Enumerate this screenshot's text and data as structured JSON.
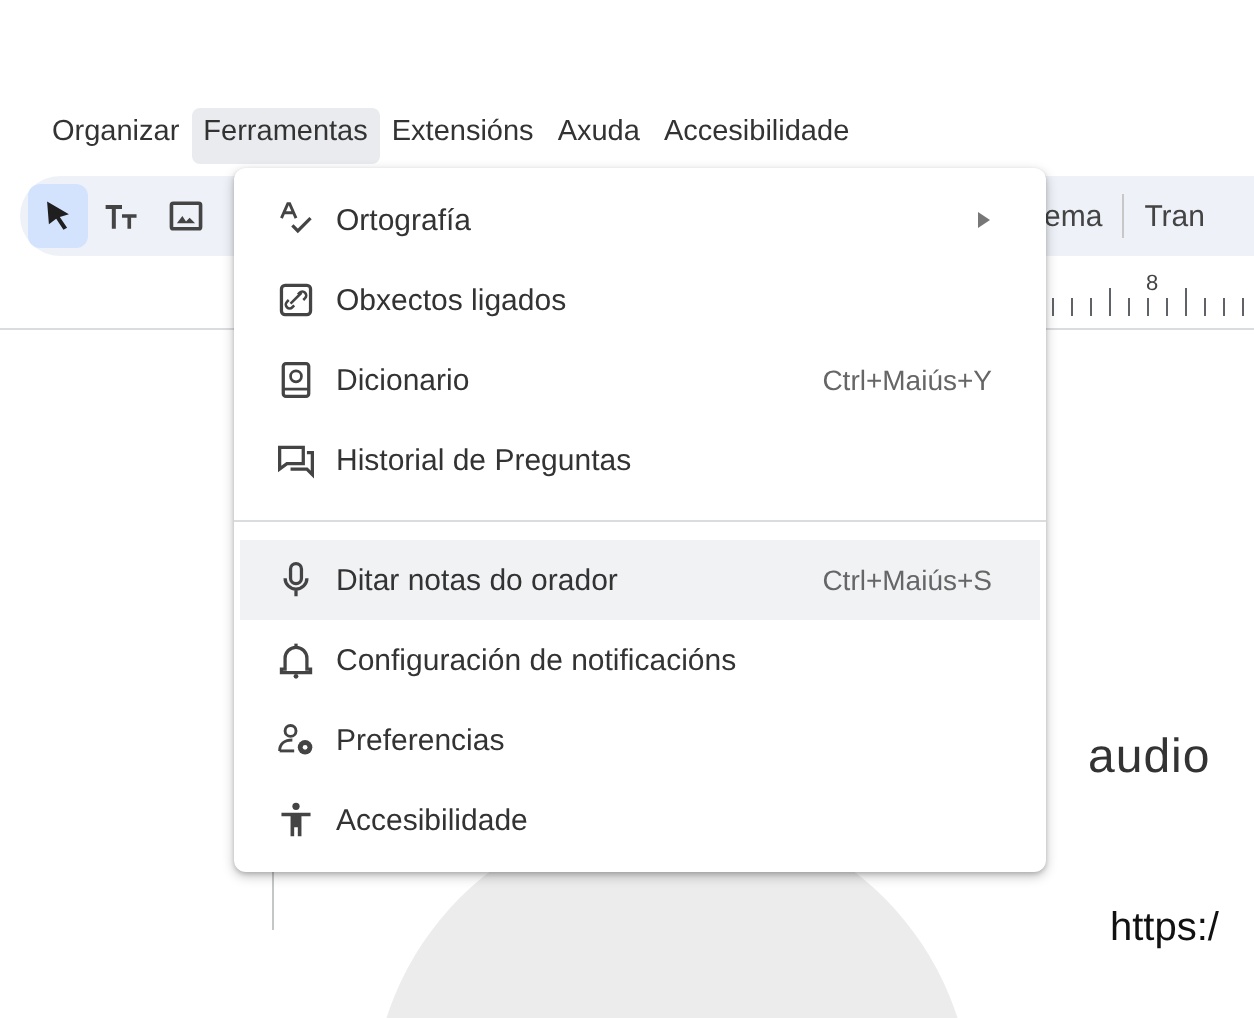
{
  "menubar": [
    {
      "label": "Organizar",
      "selected": false
    },
    {
      "label": "Ferramentas",
      "selected": true
    },
    {
      "label": "Extensións",
      "selected": false
    },
    {
      "label": "Axuda",
      "selected": false
    },
    {
      "label": "Accesibilidade",
      "selected": false
    }
  ],
  "toolbar": {
    "tools": [
      {
        "selected": true
      },
      {
        "selected": false
      },
      {
        "selected": false
      }
    ],
    "buttons": [
      "ema",
      "Tran"
    ]
  },
  "ruler": {
    "label": "8"
  },
  "menu": {
    "items": [
      {
        "kind": "item",
        "label": "Ortografía",
        "submenu": true,
        "hovered": false
      },
      {
        "kind": "item",
        "label": "Obxectos ligados",
        "submenu": false,
        "hovered": false
      },
      {
        "kind": "item",
        "label": "Dicionario",
        "shortcut": "Ctrl+Maiús+Y",
        "submenu": false,
        "hovered": false
      },
      {
        "kind": "item",
        "label": "Historial de Preguntas",
        "submenu": false,
        "hovered": false
      },
      {
        "kind": "separator"
      },
      {
        "kind": "item",
        "label": "Ditar notas do orador",
        "shortcut": "Ctrl+Maiús+S",
        "submenu": false,
        "hovered": true
      },
      {
        "kind": "item",
        "label": "Configuración de notificacións",
        "submenu": false,
        "hovered": false
      },
      {
        "kind": "item",
        "label": "Preferencias",
        "submenu": false,
        "hovered": false
      },
      {
        "kind": "item",
        "label": "Accesibilidade",
        "submenu": false,
        "hovered": false
      }
    ]
  },
  "slide": {
    "texts": [
      "audio",
      "https:/"
    ]
  }
}
